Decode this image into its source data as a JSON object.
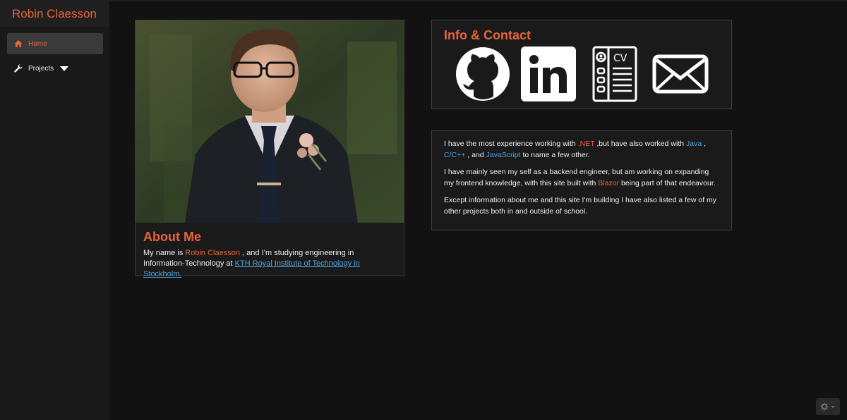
{
  "sidebar": {
    "brand": "Robin Claesson",
    "items": [
      {
        "label": "Home",
        "icon": "home-icon"
      },
      {
        "label": "Projects",
        "icon": "wrench-icon"
      }
    ]
  },
  "about": {
    "heading": "About Me",
    "text_1": "My name is ",
    "name": "Robin Claesson",
    "text_2": " , and I’m studying engineering in Information-Technology at ",
    "link": "KTH Royal Institute of Technology in Stockholm."
  },
  "info": {
    "heading": "Info & Contact",
    "icons": [
      "github-icon",
      "linkedin-icon",
      "cv-icon",
      "mail-icon"
    ]
  },
  "bio": {
    "p1_a": "I have the most experience working with ",
    "p1_net": ".NET",
    "p1_b": " ,but have also worked with ",
    "p1_java": "Java",
    "p1_c": " , ",
    "p1_cpp": "C/C++",
    "p1_d": " , and ",
    "p1_js": "JavaScript",
    "p1_e": " to name a few other.",
    "p2_a": "I have mainly seen my self as a backend engineer, but am working on expanding my frontend knowledge, with this site built with ",
    "p2_blazor": "Blazor",
    "p2_b": " being part of that endeavour.",
    "p3": "Except information about me and this site I'm building I have also listed a few of my other projects both in and outside of school."
  },
  "colors": {
    "accent": "#e8643c",
    "link": "#4ea3dc",
    "background": "#121212",
    "sidebar": "#191919"
  }
}
